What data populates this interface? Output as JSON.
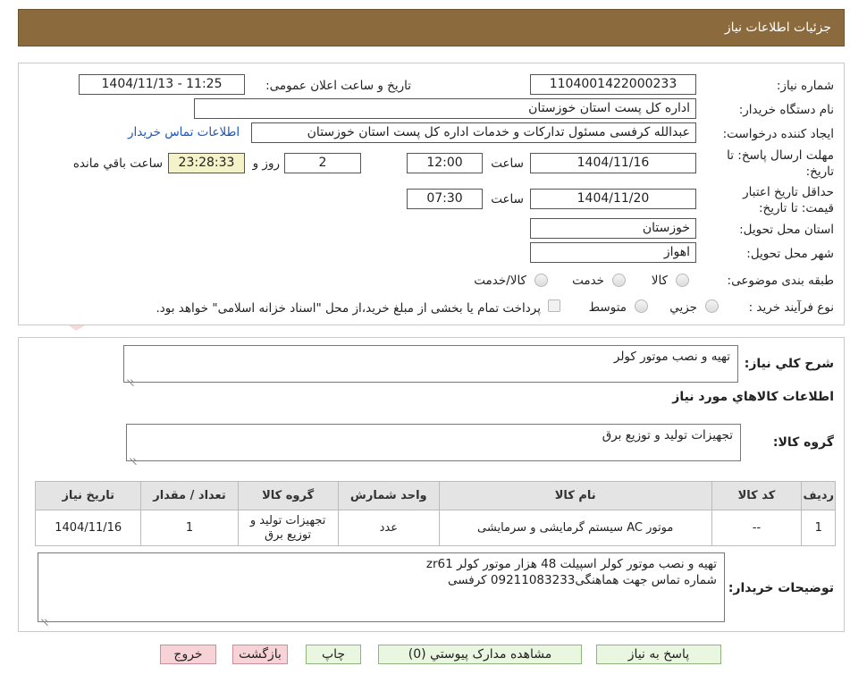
{
  "header": {
    "title": "جزئیات اطلاعات نیاز"
  },
  "fields": {
    "need_number_label": "شماره نیاز:",
    "need_number": "1104001422000233",
    "announce_label": "تاریخ و ساعت اعلان عمومی:",
    "announce_value": "1404/11/13 - 11:25",
    "buyer_label": "نام دستگاه خریدار:",
    "buyer_value": "اداره کل پست استان خوزستان",
    "creator_label": "ایجاد کننده درخواست:",
    "creator_value": "عبدالله کرفسی مسئول تدارکات و خدمات اداره کل پست استان خوزستان",
    "contact_link": "اطلاعات تماس خریدار",
    "deadline_label_1": "مهلت ارسال پاسخ: تا",
    "deadline_label_2": "تاریخ:",
    "deadline_date": "1404/11/16",
    "time_label": "ساعت",
    "deadline_time": "12:00",
    "days_value": "2",
    "days_label": "روز و",
    "remaining_value": "23:28:33",
    "remaining_label": "ساعت باقي مانده",
    "validity_label_1": "حداقل تاریخ اعتبار",
    "validity_label_2": "قیمت: تا تاریخ:",
    "validity_date": "1404/11/20",
    "validity_time": "07:30",
    "province_label": "استان محل تحویل:",
    "province_value": "خوزستان",
    "city_label": "شهر محل تحویل:",
    "city_value": "اهواز",
    "category_label": "طبقه بندی موضوعی:",
    "category_options": [
      "کالا",
      "خدمت",
      "کالا/خدمت"
    ],
    "process_label": "نوع فرآیند خرید :",
    "process_options": [
      "جزیي",
      "متوسط"
    ],
    "payment_note": "پرداخت تمام یا بخشی از مبلغ خرید،از محل \"اسناد خزانه اسلامی\" خواهد بود."
  },
  "details": {
    "summary_label": "شرح کلي نياز:",
    "summary_value": "تهيه و نصب موتور کولر",
    "goods_info_title": "اطلاعات کالاهاي مورد نياز",
    "group_label": "گروه کالا:",
    "group_value": "تجهيزات توليد و توزيع برق"
  },
  "table": {
    "headers": [
      "رديف",
      "کد کالا",
      "نام کالا",
      "واحد شمارش",
      "گروه کالا",
      "تعداد / مقدار",
      "تاريخ نياز"
    ],
    "rows": [
      [
        "1",
        "--",
        "موتور AC سیستم گرمایشی و سرمایشی",
        "عدد",
        "تجهيزات توليد و توزيع برق",
        "1",
        "1404/11/16"
      ]
    ]
  },
  "buyer_notes": {
    "label": "توضيحات خريدار:",
    "line1": "تهیه و نصب موتور کولر اسپیلت 48 هزار موتور کولر zr61",
    "line2": "شماره تماس جهت هماهنگی09211083233 کرفسی"
  },
  "buttons": {
    "reply": "پاسخ به نياز",
    "attachments": "مشاهده مدارک پيوستي (0)",
    "print": "چاپ",
    "back": "بازگشت",
    "exit": "خروج"
  },
  "colors": {
    "header_bg": "#8b6a3e",
    "link": "#1a56c4",
    "remaining_bg": "#f4f2c8",
    "green_button": "#e9f6e0",
    "pink_button": "#f7d3d8"
  }
}
